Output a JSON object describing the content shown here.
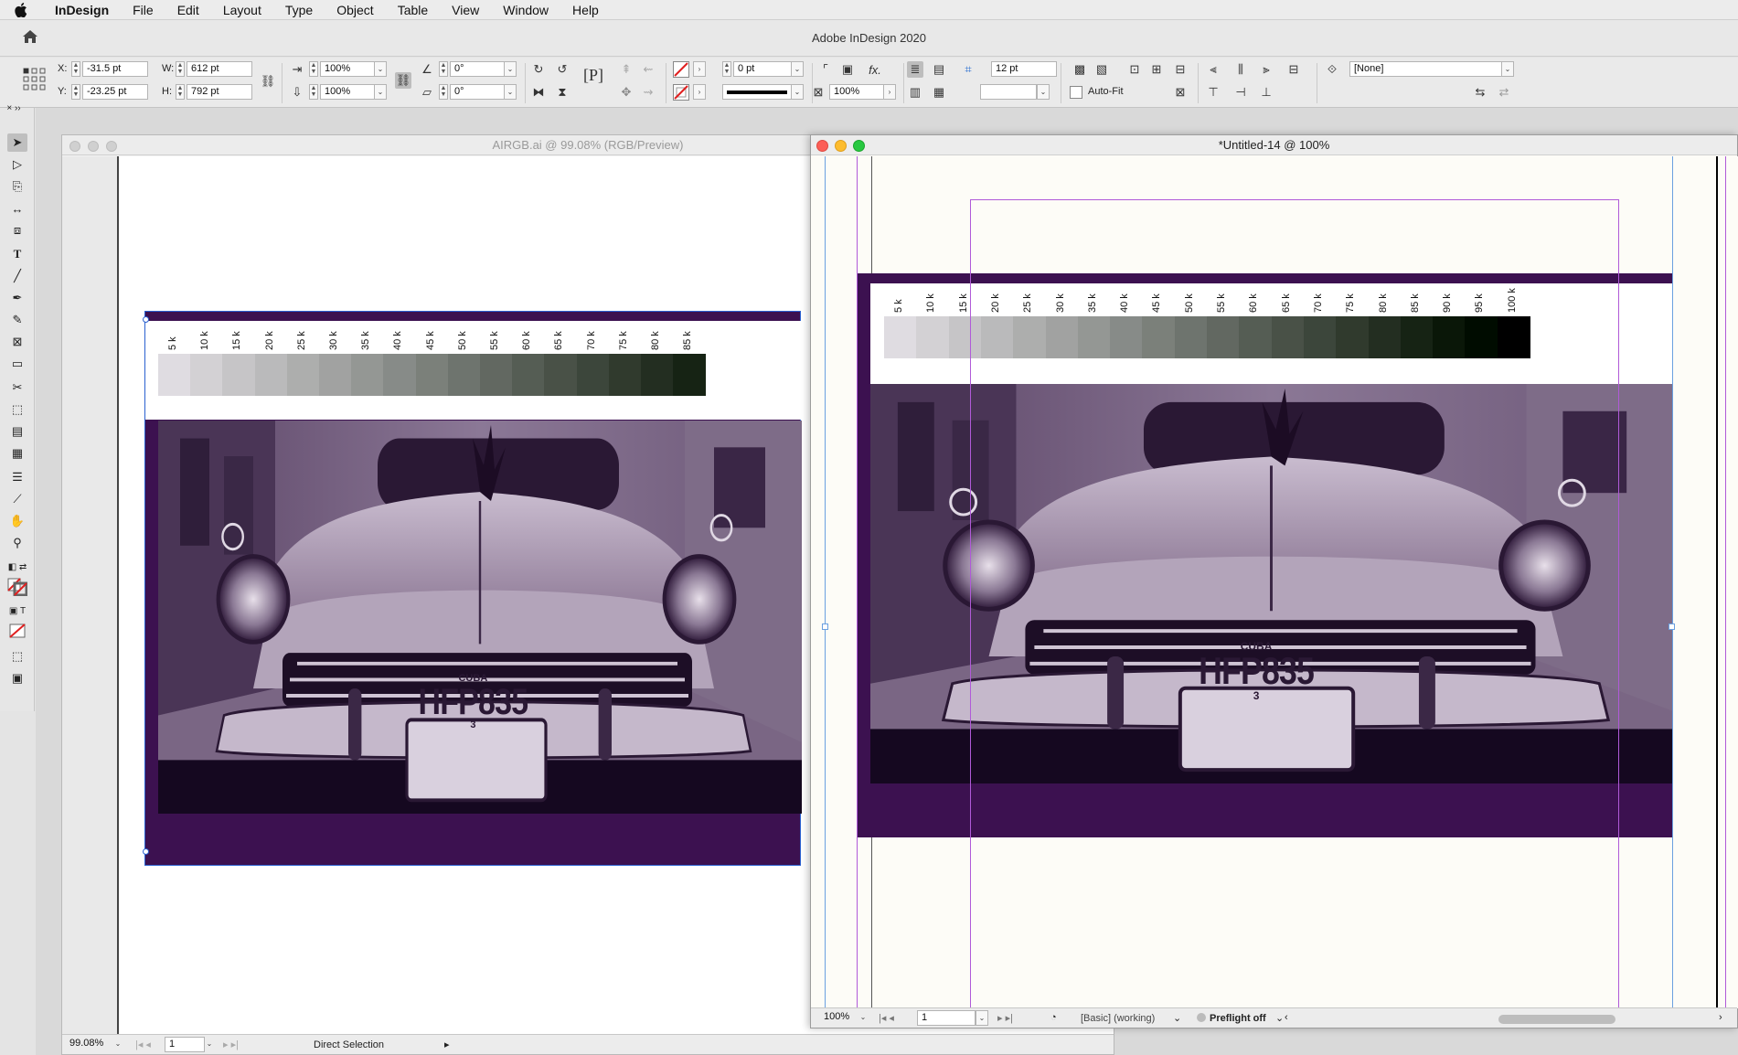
{
  "menubar": {
    "app_name": "InDesign",
    "items": [
      "File",
      "Edit",
      "Layout",
      "Type",
      "Object",
      "Table",
      "View",
      "Window",
      "Help"
    ]
  },
  "titlebar": {
    "title": "Adobe InDesign 2020"
  },
  "control": {
    "x_label": "X:",
    "x_value": "-31.5 pt",
    "y_label": "Y:",
    "y_value": "-23.25 pt",
    "w_label": "W:",
    "w_value": "612 pt",
    "h_label": "H:",
    "h_value": "792 pt",
    "scale_x": "100%",
    "scale_y": "100%",
    "rotate": "0°",
    "shear": "0°",
    "stroke_weight": "0 pt",
    "opacity": "100%",
    "gutter": "12 pt",
    "autofit_label": "Auto-Fit",
    "object_style": "[None]"
  },
  "doc1": {
    "title": "AIRGB.ai @ 99.08% (RGB/Preview)",
    "zoom": "99.08%",
    "page": "1",
    "status": "Direct Selection"
  },
  "doc2": {
    "title": "*Untitled-14 @ 100%",
    "zoom": "100%",
    "page": "1",
    "style": "[Basic] (working)",
    "preflight": "Preflight off"
  },
  "scale_labels": [
    "5 k",
    "10 k",
    "15 k",
    "20 k",
    "25 k",
    "30 k",
    "35 k",
    "40 k",
    "45 k",
    "50 k",
    "55 k",
    "60 k",
    "65 k",
    "70 k",
    "75 k",
    "80 k",
    "85 k",
    "90 k",
    "95 k",
    "100 k"
  ],
  "plate": {
    "country": "CUBA",
    "number": "HFP835",
    "sub": "3"
  },
  "colors": {
    "brand_purple": "#3c1150",
    "guide_purple": "#b05ad8",
    "guide_blue": "#6aa0e0"
  }
}
